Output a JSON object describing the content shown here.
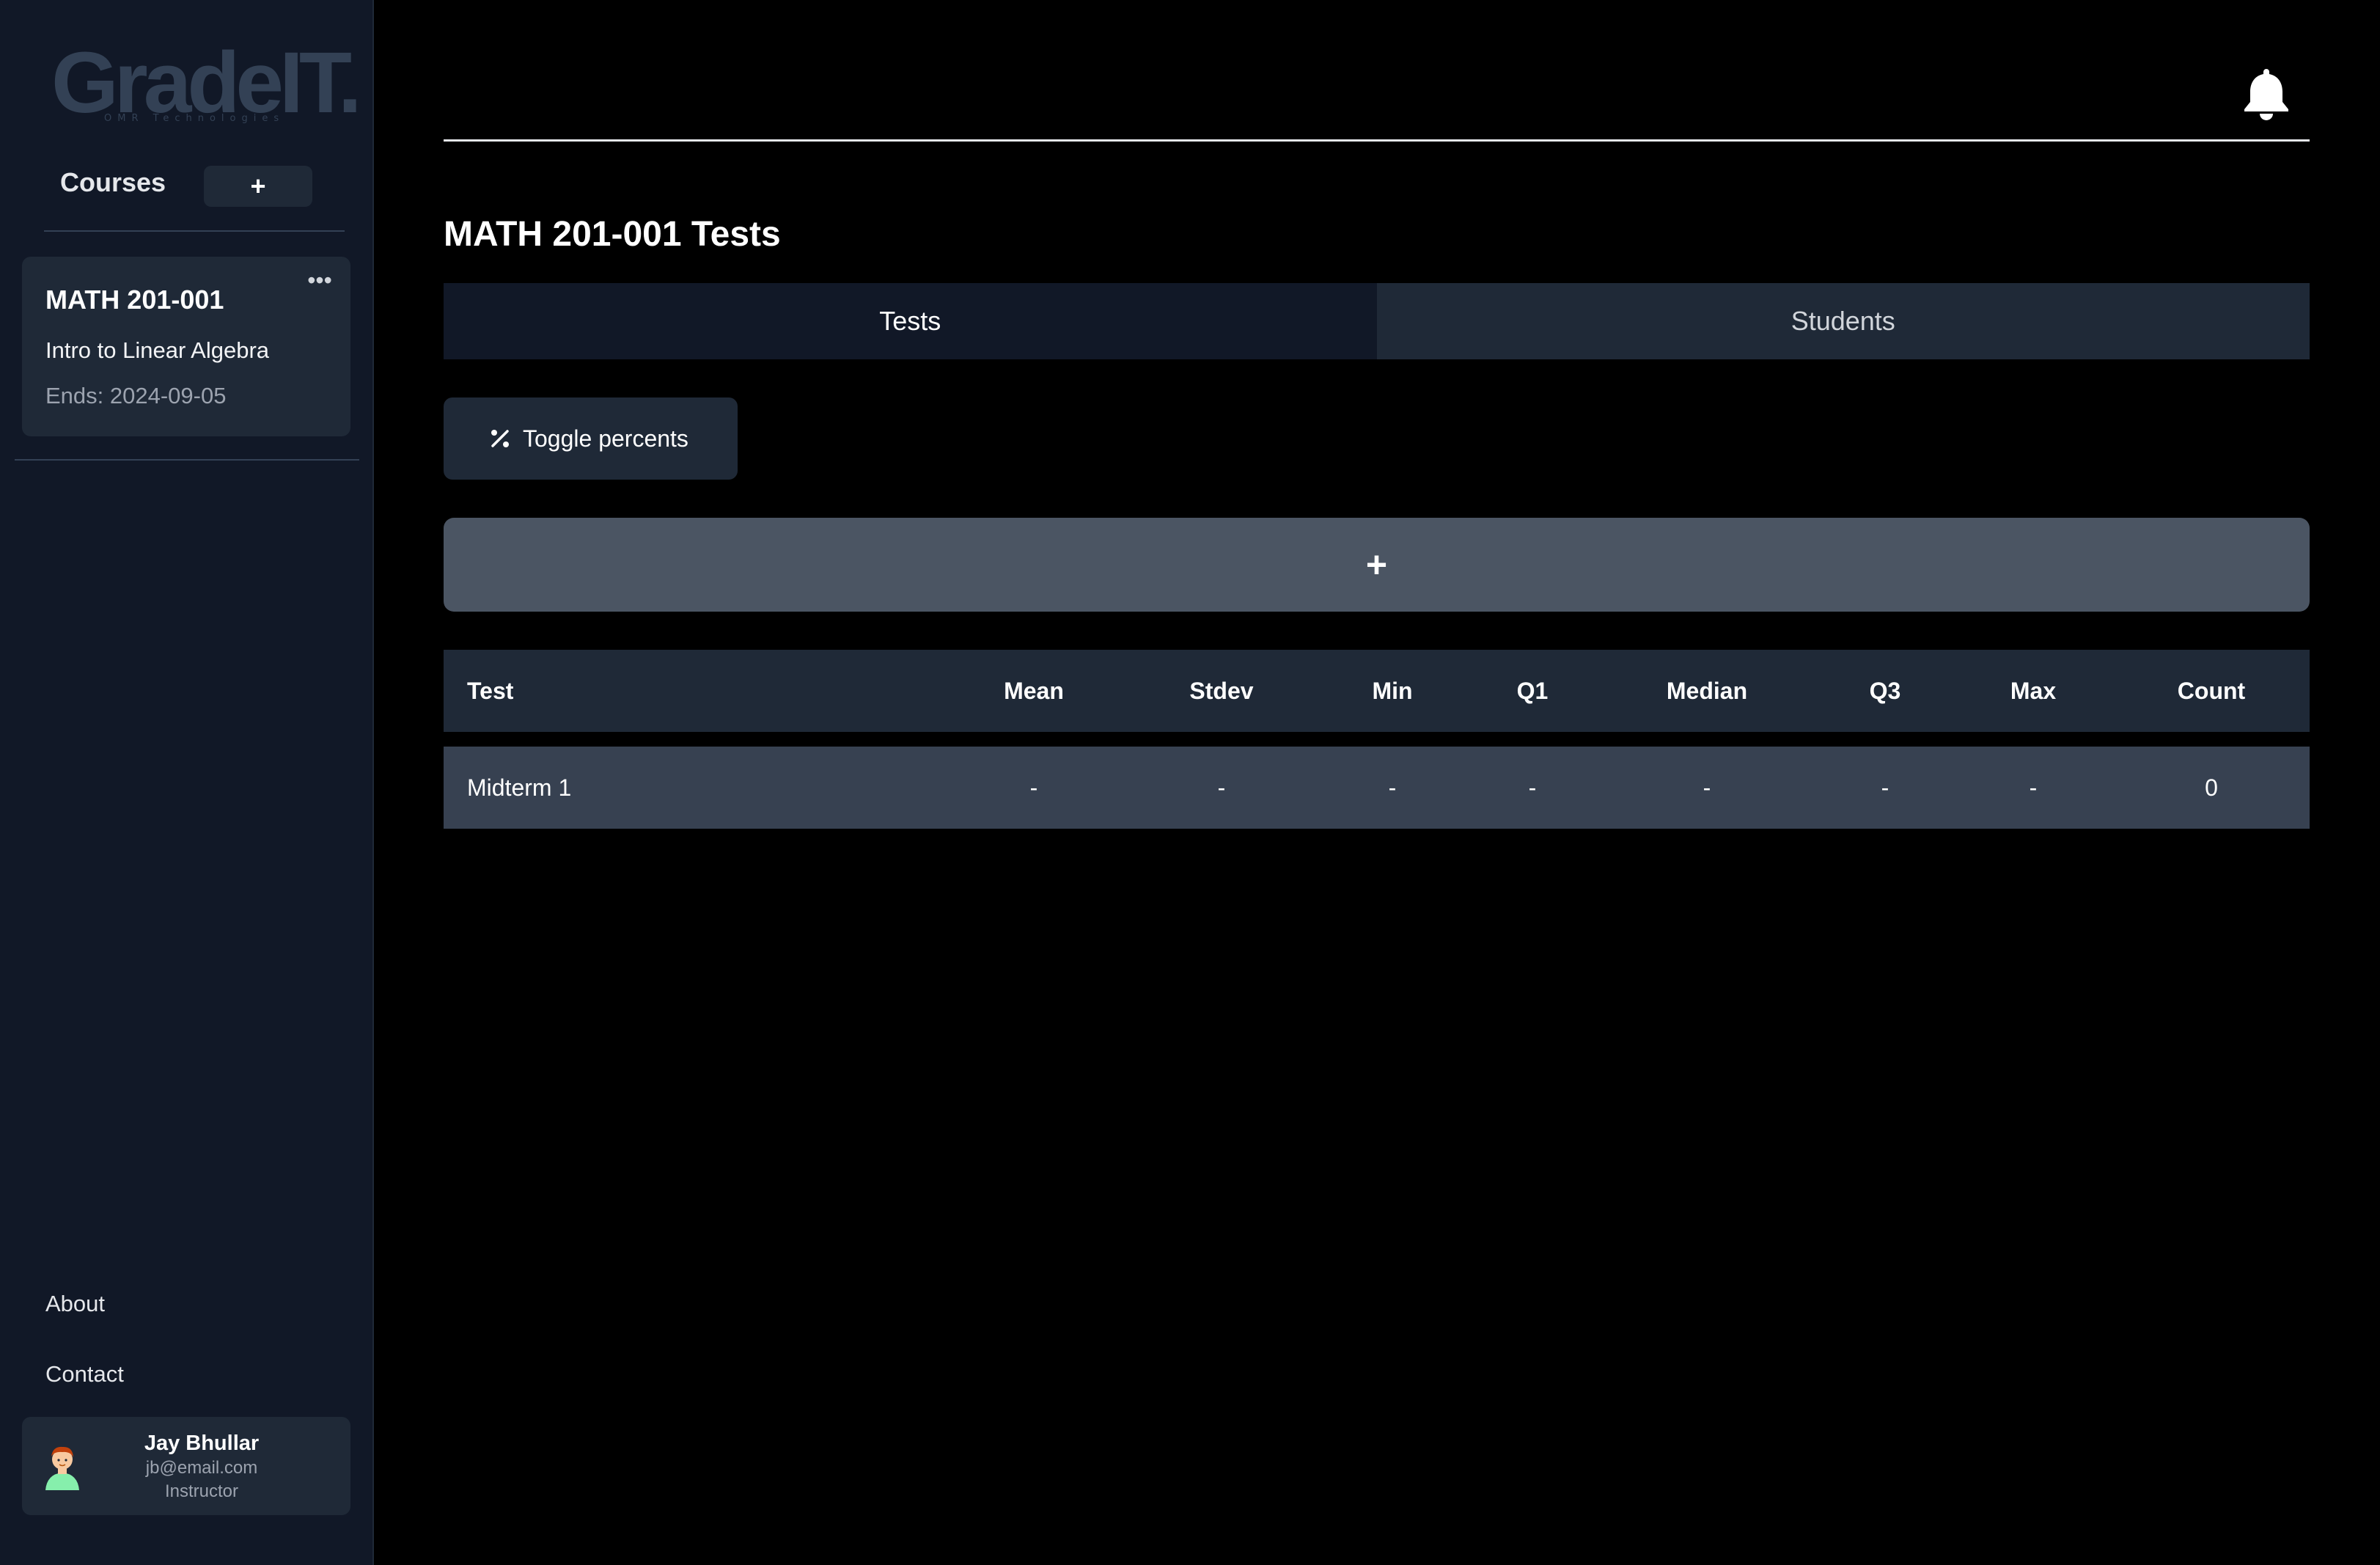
{
  "brand": {
    "logo_text": "GradeIT.",
    "logo_tagline": "OMR Technologies",
    "logo_color": "#334155"
  },
  "sidebar": {
    "courses_label": "Courses",
    "add_course_label": "+",
    "courses": [
      {
        "code": "MATH 201-001",
        "more_label": "•••",
        "name": "Intro to Linear Algebra",
        "ends": "Ends: 2024-09-05"
      }
    ],
    "nav": {
      "about": "About",
      "contact": "Contact"
    },
    "user": {
      "name": "Jay Bhullar",
      "email": "jb@email.com",
      "role": "Instructor",
      "avatar_icon": "person-avatar-icon"
    }
  },
  "header": {
    "notification_icon": "bell-icon"
  },
  "main": {
    "title": "MATH 201-001 Tests",
    "tabs": [
      {
        "label": "Tests",
        "active": true
      },
      {
        "label": "Students",
        "active": false
      }
    ],
    "toggle_percents_label": "Toggle percents",
    "toggle_percents_icon": "percent-icon",
    "add_test_label": "+",
    "table": {
      "headers": {
        "test": "Test",
        "mean": "Mean",
        "stdev": "Stdev",
        "min": "Min",
        "q1": "Q1",
        "median": "Median",
        "q3": "Q3",
        "max": "Max",
        "count": "Count"
      },
      "rows": [
        {
          "test": "Midterm 1",
          "mean": "-",
          "stdev": "-",
          "min": "-",
          "q1": "-",
          "median": "-",
          "q3": "-",
          "max": "-",
          "count": "0"
        }
      ]
    }
  },
  "colors": {
    "page_bg": "#000000",
    "sidebar_bg": "#111827",
    "card_bg": "#1f2937",
    "row_bg": "#374151",
    "add_button_bg": "#4b5563"
  }
}
